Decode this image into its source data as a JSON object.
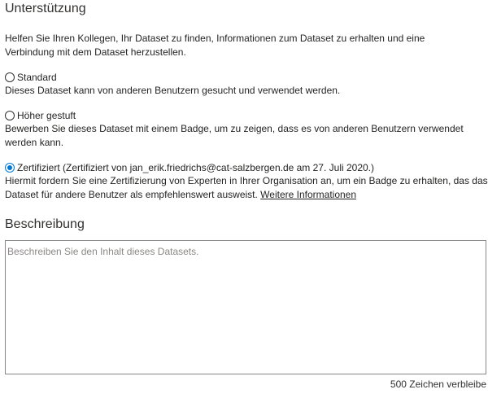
{
  "support": {
    "title": "Unterstützung",
    "intro": "Helfen Sie Ihren Kollegen, Ihr Dataset zu finden, Informationen zum Dataset zu erhalten und eine Verbindung mit dem Dataset herzustellen.",
    "options": [
      {
        "label": "Standard",
        "description": "Dieses Dataset kann von anderen Benutzern gesucht und verwendet werden.",
        "selected": false
      },
      {
        "label": "Höher gestuft",
        "description": "Bewerben Sie dieses Dataset mit einem Badge, um zu zeigen, dass es von anderen Benutzern verwendet werden kann.",
        "selected": false
      },
      {
        "label": "Zertifiziert (Zertifiziert von jan_erik.friedrichs@cat-salzbergen.de am 27. Juli 2020.)",
        "description": "Hiermit fordern Sie eine Zertifizierung von Experten in Ihrer Organisation an, um ein Badge zu erhalten, das das Dataset für andere Benutzer als empfehlenswert ausweist.",
        "link_text": "Weitere Informationen",
        "selected": true
      }
    ]
  },
  "description": {
    "title": "Beschreibung",
    "placeholder": "Beschreiben Sie den Inhalt dieses Datasets.",
    "value": "",
    "counter": "500 Zeichen verbleibe"
  }
}
